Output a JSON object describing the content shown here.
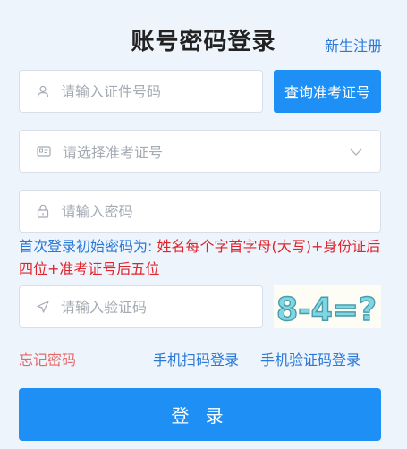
{
  "header": {
    "title": "账号密码登录",
    "register_link": "新生注册"
  },
  "form": {
    "id_placeholder": "请输入证件号码",
    "query_button": "查询准考证号",
    "ticket_placeholder": "请选择准考证号",
    "password_placeholder": "请输入密码",
    "hint_blue": "首次登录初始密码为: ",
    "hint_red": "姓名每个字首字母(大写)+身份证后四位+准考证号后五位",
    "captcha_placeholder": "请输入验证码",
    "captcha_text": "8-4=?"
  },
  "links": {
    "forgot_password": "忘记密码",
    "scan_login": "手机扫码登录",
    "sms_login": "手机验证码登录"
  },
  "actions": {
    "login_button": "登 录"
  },
  "colors": {
    "primary": "#1e90f5",
    "link_blue": "#2a78d6",
    "hint_red": "#e0242c",
    "forgot_red": "#e46a6a"
  }
}
